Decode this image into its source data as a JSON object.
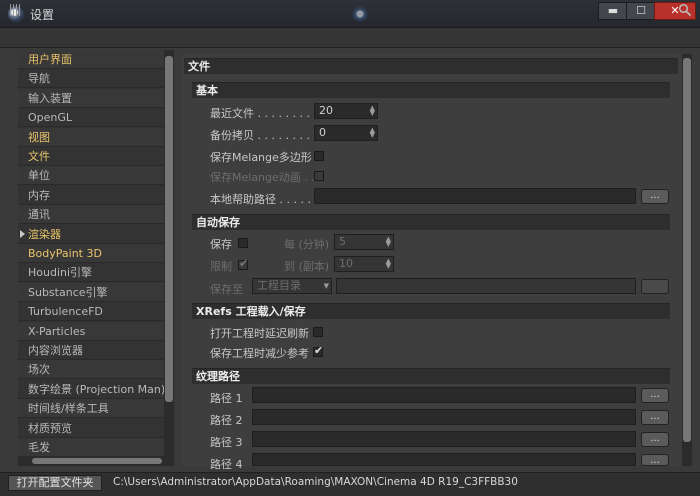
{
  "window": {
    "title": "设置",
    "minimize": "▬",
    "maximize": "☐",
    "close": "✕"
  },
  "tree": {
    "items": [
      {
        "label": "用户界面",
        "style": "hl"
      },
      {
        "label": "导航",
        "style": ""
      },
      {
        "label": "输入装置",
        "style": ""
      },
      {
        "label": "OpenGL",
        "style": ""
      },
      {
        "label": "视图",
        "style": "hl"
      },
      {
        "label": "文件",
        "style": "hl"
      },
      {
        "label": "单位",
        "style": ""
      },
      {
        "label": "内存",
        "style": ""
      },
      {
        "label": "通讯",
        "style": ""
      },
      {
        "label": "渲染器",
        "style": "hl"
      },
      {
        "label": "BodyPaint 3D",
        "style": "hl"
      },
      {
        "label": "Houdini引擎",
        "style": ""
      },
      {
        "label": "Substance引擎",
        "style": ""
      },
      {
        "label": "TurbulenceFD",
        "style": ""
      },
      {
        "label": "X-Particles",
        "style": ""
      },
      {
        "label": "内容浏览器",
        "style": ""
      },
      {
        "label": "场次",
        "style": ""
      },
      {
        "label": "数字绘景 (Projection Man)",
        "style": ""
      },
      {
        "label": "时间线/样条工具",
        "style": ""
      },
      {
        "label": "材质预览",
        "style": ""
      },
      {
        "label": "毛发",
        "style": ""
      }
    ]
  },
  "panel": {
    "section_title": "文件",
    "basic": {
      "title": "基本",
      "recent_files_label": "最近文件 . . . . . . . . . .",
      "recent_files_value": "20",
      "backup_label": "备份拷贝 . . . . . . . . . .",
      "backup_value": "0",
      "save_melange_poly_label": "保存Melange多边形",
      "save_melange_anim_label": "保存Melange动画 . . .",
      "local_help_label": "本地帮助路径 . . . . .",
      "local_help_value": "",
      "dots": "..."
    },
    "autosave": {
      "title": "自动保存",
      "save_label": "保存",
      "every_min_label": "每 (分钟)",
      "every_min_value": "5",
      "limit_label": "限制",
      "count_label": "到 (副本)",
      "count_value": "10",
      "save_at_label": "保存至",
      "save_at_value": "工程目录"
    },
    "xrefs": {
      "title": "XRefs 工程载入/保存",
      "delay_refresh_label": "打开工程时延迟刷新",
      "save_reduce_ref_label": "保存工程时减少参考"
    },
    "texture_paths": {
      "title": "纹理路径",
      "path1": "路径 1",
      "path2": "路径 2",
      "path3": "路径 3",
      "path4": "路径 4"
    }
  },
  "bottom": {
    "open_config_label": "打开配置文件夹",
    "config_path": "C:\\Users\\Administrator\\AppData\\Roaming\\MAXON\\Cinema 4D R19_C3FFBB30"
  }
}
